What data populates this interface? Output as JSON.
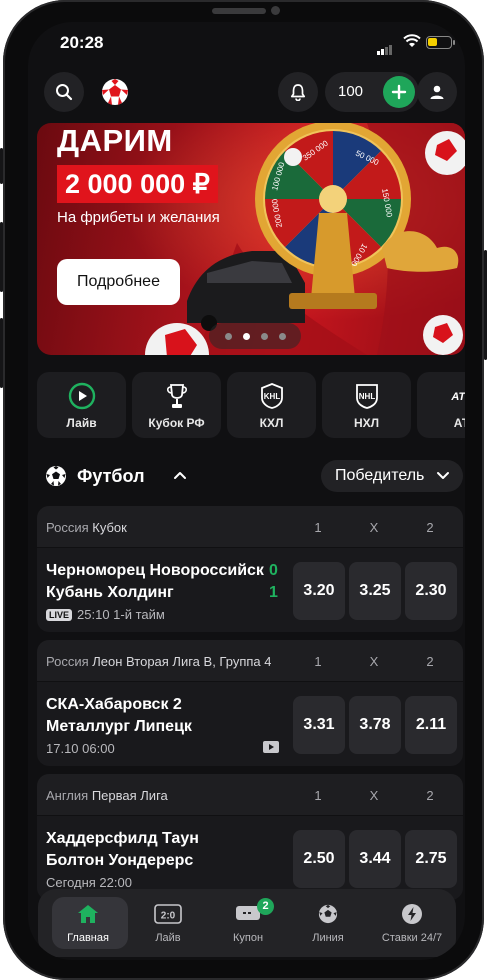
{
  "status_bar": {
    "time": "20:28"
  },
  "header": {
    "balance": "100"
  },
  "banner": {
    "title": "ДАРИМ",
    "amount": "2 000 000 ₽",
    "subtitle": "На фрибеты и желания",
    "button": "Подробнее",
    "wheel_labels": [
      "350 000",
      "50 000",
      "150 000",
      "200 000",
      "100 000",
      "10 000"
    ],
    "slides": 4,
    "active_slide": 2
  },
  "categories": [
    {
      "label": "Лайв",
      "icon": "play-icon"
    },
    {
      "label": "Кубок РФ",
      "icon": "cup-icon"
    },
    {
      "label": "КХЛ",
      "icon": "khl-icon"
    },
    {
      "label": "НХЛ",
      "icon": "nhl-icon"
    },
    {
      "label": "АТ",
      "icon": "atp-icon"
    }
  ],
  "section": {
    "title": "Футбол",
    "market": "Победитель"
  },
  "matches": [
    {
      "country": "Россия",
      "league": "Кубок",
      "cols": [
        "1",
        "X",
        "2"
      ],
      "team1": "Черноморец Новороссийск",
      "team2": "Кубань Холдинг",
      "score1": "0",
      "score2": "1",
      "live": "LIVE",
      "meta": "25:10 1-й тайм",
      "odds": [
        "3.20",
        "3.25",
        "2.30"
      ]
    },
    {
      "country": "Россия",
      "league": "Леон Вторая Лига В, Группа 4",
      "cols": [
        "1",
        "X",
        "2"
      ],
      "team1": "СКА-Хабаровск 2",
      "team2": "Металлург Липецк",
      "meta": "17.10 06:00",
      "odds": [
        "3.31",
        "3.78",
        "2.11"
      ]
    },
    {
      "country": "Англия",
      "league": "Первая Лига",
      "cols": [
        "1",
        "X",
        "2"
      ],
      "team1": "Хаддерсфилд Таун",
      "team2": "Болтон Уондерерс",
      "meta": "Сегодня 22:00",
      "odds": [
        "2.50",
        "3.44",
        "2.75"
      ]
    }
  ],
  "tabbar": {
    "items": [
      {
        "label": "Главная",
        "icon": "home-icon"
      },
      {
        "label": "Лайв",
        "icon": "live-score-icon"
      },
      {
        "label": "Купон",
        "icon": "coupon-icon",
        "badge": "2"
      },
      {
        "label": "Линия",
        "icon": "football-icon"
      },
      {
        "label": "Ставки 24/7",
        "icon": "lightning-icon"
      }
    ]
  },
  "colors": {
    "accent": "#1fa65a",
    "background": "#101012",
    "banner_red": "#c9161f"
  }
}
